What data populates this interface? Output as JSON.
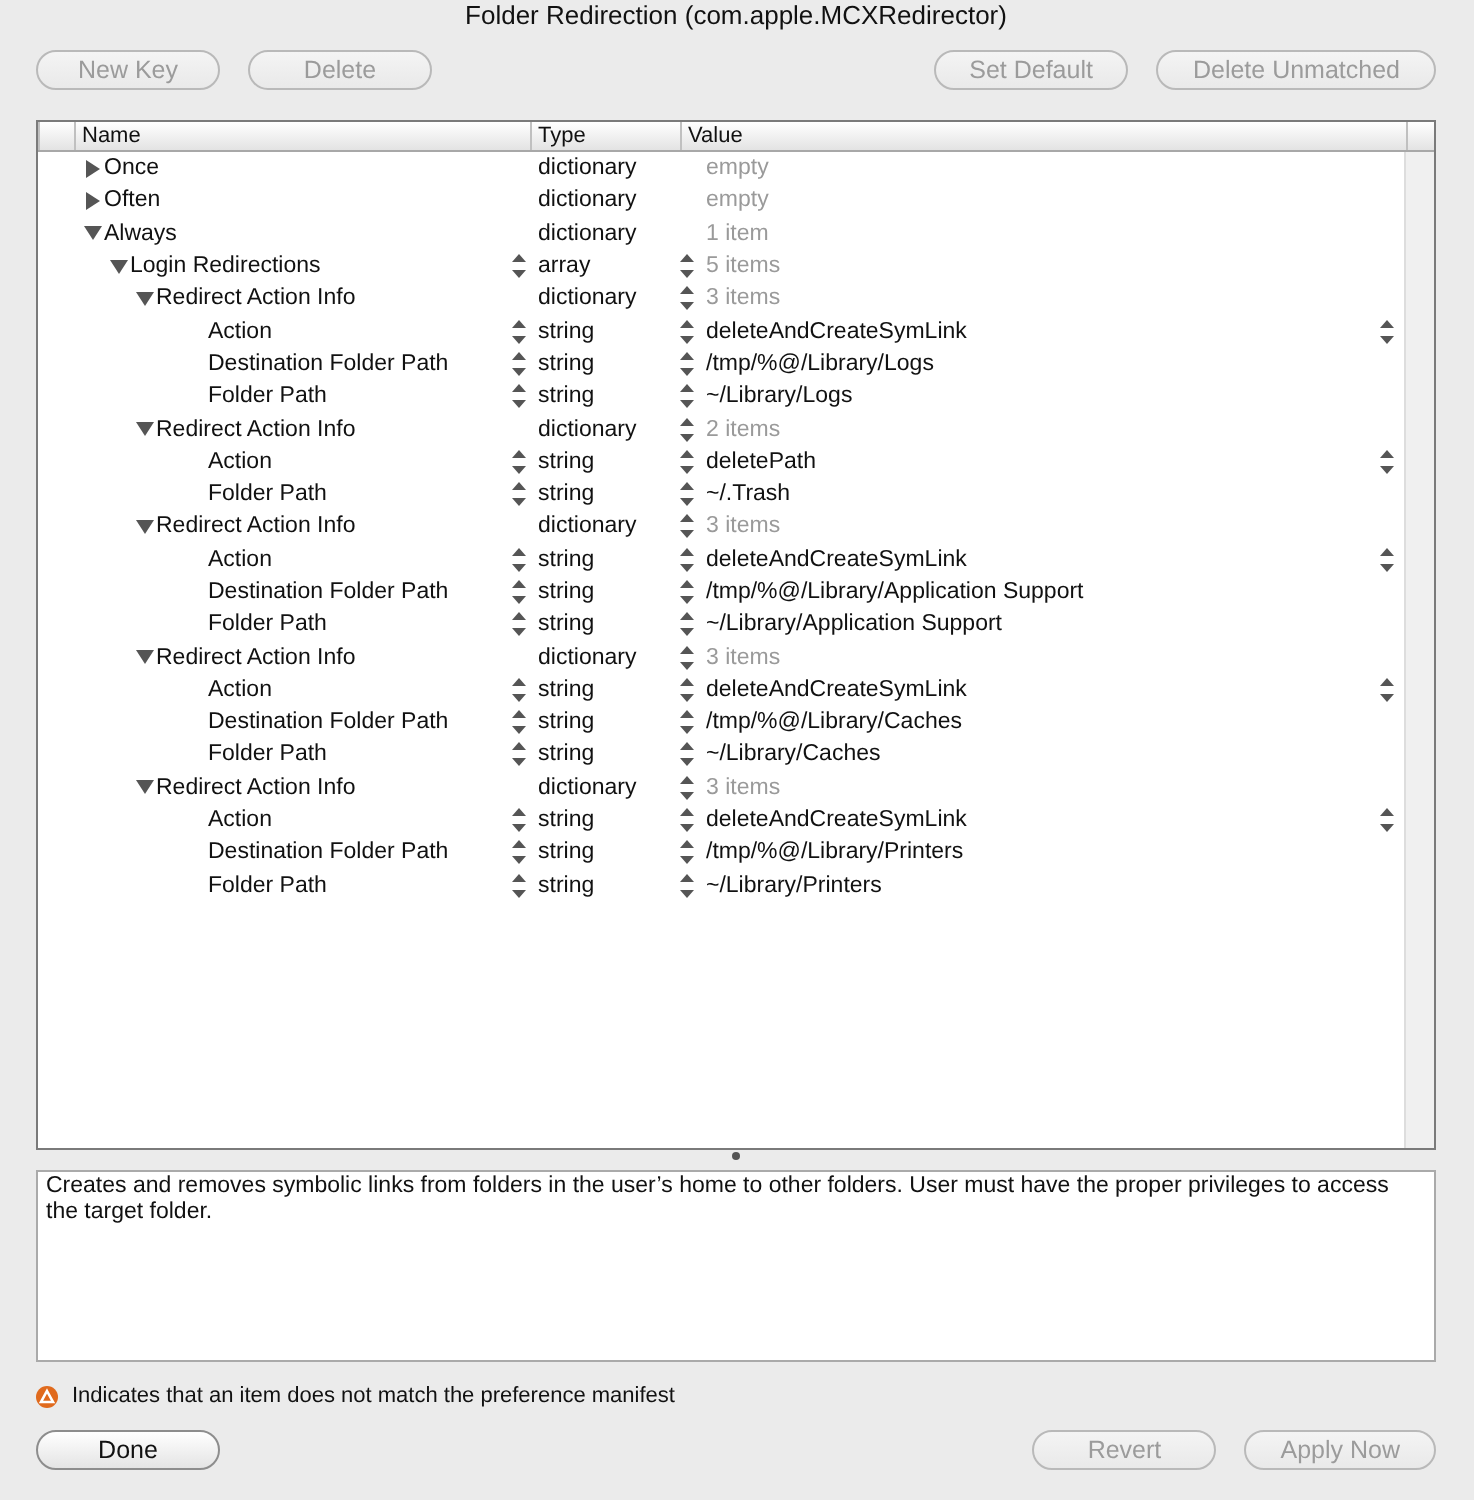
{
  "window": {
    "title": "Folder Redirection (com.apple.MCXRedirector)"
  },
  "toolbar": {
    "left_buttons": [
      {
        "label": "New Key",
        "disabled": true
      },
      {
        "label": "Delete",
        "disabled": true
      }
    ],
    "right_buttons": [
      {
        "label": "Set Default",
        "disabled": true
      },
      {
        "label": "Delete Unmatched",
        "disabled": true
      }
    ]
  },
  "table": {
    "columns": [
      "Name",
      "Type",
      "Value"
    ],
    "rows": [
      {
        "name": "Once",
        "type": "dictionary",
        "value": "empty",
        "kind": "container",
        "expanded": false,
        "type_stepper": false,
        "value_stepper": false,
        "value_popup": false
      },
      {
        "name": "Often",
        "type": "dictionary",
        "value": "empty",
        "kind": "container",
        "expanded": false,
        "type_stepper": false,
        "value_stepper": false,
        "value_popup": false
      },
      {
        "name": "Always",
        "type": "dictionary",
        "value": "1 item",
        "kind": "container",
        "expanded": true,
        "type_stepper": false,
        "value_stepper": false,
        "value_popup": false,
        "children": [
          {
            "name": "Login Redirections",
            "type": "array",
            "value": "5 items",
            "kind": "container",
            "expanded": true,
            "type_stepper": true,
            "value_stepper": true,
            "value_popup": false,
            "children": [
              {
                "name": "Redirect Action Info",
                "type": "dictionary",
                "value": "3 items",
                "kind": "container",
                "expanded": true,
                "type_stepper": false,
                "value_stepper": true,
                "value_popup": false,
                "children": [
                  {
                    "name": "Action",
                    "type": "string",
                    "value": "deleteAndCreateSymLink",
                    "kind": "leaf",
                    "type_stepper": true,
                    "value_stepper": true,
                    "value_popup": true
                  },
                  {
                    "name": "Destination Folder Path",
                    "type": "string",
                    "value": "/tmp/%@/Library/Logs",
                    "kind": "leaf",
                    "type_stepper": true,
                    "value_stepper": true,
                    "value_popup": false
                  },
                  {
                    "name": "Folder Path",
                    "type": "string",
                    "value": "~/Library/Logs",
                    "kind": "leaf",
                    "type_stepper": true,
                    "value_stepper": true,
                    "value_popup": false
                  }
                ]
              },
              {
                "name": "Redirect Action Info",
                "type": "dictionary",
                "value": "2 items",
                "kind": "container",
                "expanded": true,
                "type_stepper": false,
                "value_stepper": true,
                "value_popup": false,
                "children": [
                  {
                    "name": "Action",
                    "type": "string",
                    "value": "deletePath",
                    "kind": "leaf",
                    "type_stepper": true,
                    "value_stepper": true,
                    "value_popup": true
                  },
                  {
                    "name": "Folder Path",
                    "type": "string",
                    "value": "~/.Trash",
                    "kind": "leaf",
                    "type_stepper": true,
                    "value_stepper": true,
                    "value_popup": false
                  }
                ]
              },
              {
                "name": "Redirect Action Info",
                "type": "dictionary",
                "value": "3 items",
                "kind": "container",
                "expanded": true,
                "type_stepper": false,
                "value_stepper": true,
                "value_popup": false,
                "children": [
                  {
                    "name": "Action",
                    "type": "string",
                    "value": "deleteAndCreateSymLink",
                    "kind": "leaf",
                    "type_stepper": true,
                    "value_stepper": true,
                    "value_popup": true
                  },
                  {
                    "name": "Destination Folder Path",
                    "type": "string",
                    "value": "/tmp/%@/Library/Application Support",
                    "kind": "leaf",
                    "type_stepper": true,
                    "value_stepper": true,
                    "value_popup": false
                  },
                  {
                    "name": "Folder Path",
                    "type": "string",
                    "value": "~/Library/Application Support",
                    "kind": "leaf",
                    "type_stepper": true,
                    "value_stepper": true,
                    "value_popup": false
                  }
                ]
              },
              {
                "name": "Redirect Action Info",
                "type": "dictionary",
                "value": "3 items",
                "kind": "container",
                "expanded": true,
                "type_stepper": false,
                "value_stepper": true,
                "value_popup": false,
                "children": [
                  {
                    "name": "Action",
                    "type": "string",
                    "value": "deleteAndCreateSymLink",
                    "kind": "leaf",
                    "type_stepper": true,
                    "value_stepper": true,
                    "value_popup": true
                  },
                  {
                    "name": "Destination Folder Path",
                    "type": "string",
                    "value": "/tmp/%@/Library/Caches",
                    "kind": "leaf",
                    "type_stepper": true,
                    "value_stepper": true,
                    "value_popup": false
                  },
                  {
                    "name": "Folder Path",
                    "type": "string",
                    "value": "~/Library/Caches",
                    "kind": "leaf",
                    "type_stepper": true,
                    "value_stepper": true,
                    "value_popup": false
                  }
                ]
              },
              {
                "name": "Redirect Action Info",
                "type": "dictionary",
                "value": "3 items",
                "kind": "container",
                "expanded": true,
                "type_stepper": false,
                "value_stepper": true,
                "value_popup": false,
                "children": [
                  {
                    "name": "Action",
                    "type": "string",
                    "value": "deleteAndCreateSymLink",
                    "kind": "leaf",
                    "type_stepper": true,
                    "value_stepper": true,
                    "value_popup": true
                  },
                  {
                    "name": "Destination Folder Path",
                    "type": "string",
                    "value": "/tmp/%@/Library/Printers",
                    "kind": "leaf",
                    "type_stepper": true,
                    "value_stepper": true,
                    "value_popup": false
                  },
                  {
                    "name": "Folder Path",
                    "type": "string",
                    "value": "~/Library/Printers",
                    "kind": "leaf",
                    "type_stepper": true,
                    "value_stepper": true,
                    "value_popup": false
                  }
                ]
              }
            ]
          }
        ]
      }
    ]
  },
  "description": "Creates and removes symbolic links from folders in the user’s home to other folders. User must have the proper privileges to access the target folder.",
  "legend": "Indicates that an item does not match the preference manifest",
  "footer": {
    "left_buttons": [
      {
        "label": "Done",
        "disabled": false
      }
    ],
    "right_buttons": [
      {
        "label": "Revert",
        "disabled": true
      },
      {
        "label": "Apply Now",
        "disabled": true
      }
    ]
  }
}
